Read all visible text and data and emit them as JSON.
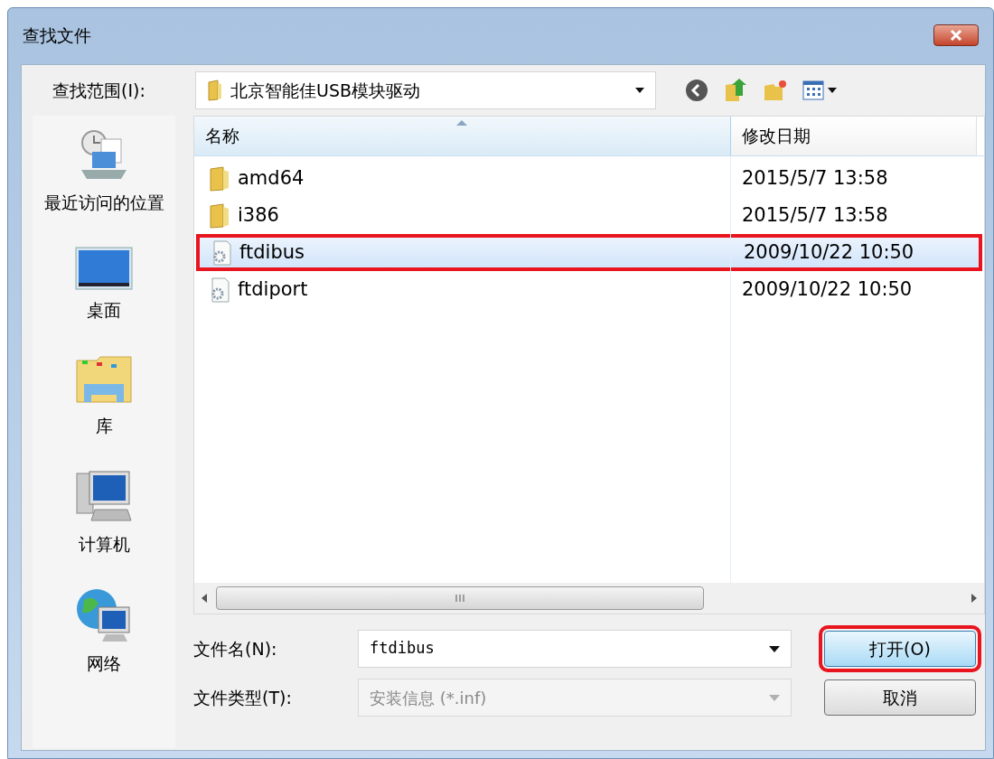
{
  "window": {
    "title": "查找文件"
  },
  "look_in": {
    "label": "查找范围(I):",
    "value": "北京智能佳USB模块驱动"
  },
  "sidebar": {
    "items": [
      {
        "label": "最近访问的位置",
        "kind": "recent"
      },
      {
        "label": "桌面",
        "kind": "desktop"
      },
      {
        "label": "库",
        "kind": "library"
      },
      {
        "label": "计算机",
        "kind": "computer"
      },
      {
        "label": "网络",
        "kind": "network"
      }
    ]
  },
  "file_list": {
    "columns": [
      "名称",
      "修改日期"
    ],
    "rows": [
      {
        "name": "amd64",
        "modified": "2015/5/7 13:58",
        "kind": "folder",
        "selected": false,
        "highlighted": false
      },
      {
        "name": "i386",
        "modified": "2015/5/7 13:58",
        "kind": "folder",
        "selected": false,
        "highlighted": false
      },
      {
        "name": "ftdibus",
        "modified": "2009/10/22 10:50",
        "kind": "setup",
        "selected": true,
        "highlighted": true
      },
      {
        "name": "ftdiport",
        "modified": "2009/10/22 10:50",
        "kind": "setup",
        "selected": false,
        "highlighted": false
      }
    ]
  },
  "file_name": {
    "label": "文件名(N):",
    "value": "ftdibus"
  },
  "file_type": {
    "label": "文件类型(T):",
    "value": "安装信息 (*.inf)",
    "disabled": true
  },
  "buttons": [
    {
      "label": "打开(O)",
      "highlighted": true
    },
    {
      "label": "取消",
      "highlighted": false
    }
  ]
}
